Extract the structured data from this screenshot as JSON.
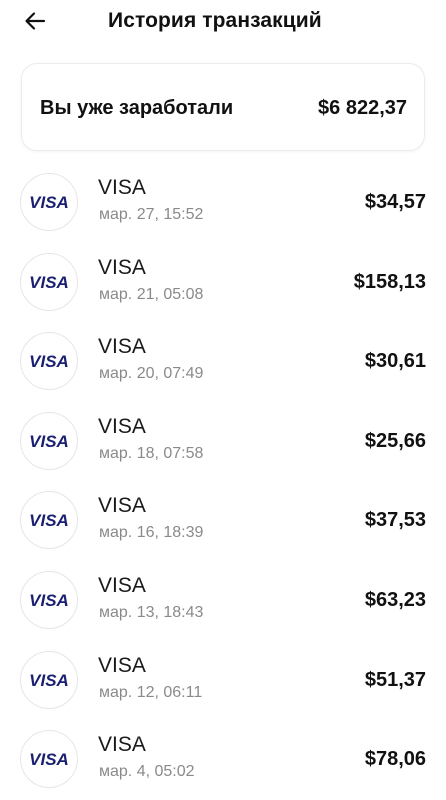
{
  "header": {
    "back_icon": "arrow-left-icon",
    "title": "История транзакций"
  },
  "summary": {
    "label": "Вы уже заработали",
    "amount": "$6 822,37"
  },
  "colors": {
    "visa_blue": "#1a1f71",
    "date_gray": "#8a8a8a"
  },
  "transactions": [
    {
      "logo_text": "VISA",
      "name": "VISA",
      "date": "мар. 27, 15:52",
      "amount": "$34,57"
    },
    {
      "logo_text": "VISA",
      "name": "VISA",
      "date": "мар. 21, 05:08",
      "amount": "$158,13"
    },
    {
      "logo_text": "VISA",
      "name": "VISA",
      "date": "мар. 20, 07:49",
      "amount": "$30,61"
    },
    {
      "logo_text": "VISA",
      "name": "VISA",
      "date": "мар. 18, 07:58",
      "amount": "$25,66"
    },
    {
      "logo_text": "VISA",
      "name": "VISA",
      "date": "мар. 16, 18:39",
      "amount": "$37,53"
    },
    {
      "logo_text": "VISA",
      "name": "VISA",
      "date": "мар. 13, 18:43",
      "amount": "$63,23"
    },
    {
      "logo_text": "VISA",
      "name": "VISA",
      "date": "мар. 12, 06:11",
      "amount": "$51,37"
    },
    {
      "logo_text": "VISA",
      "name": "VISA",
      "date": "мар. 4, 05:02",
      "amount": "$78,06"
    }
  ]
}
